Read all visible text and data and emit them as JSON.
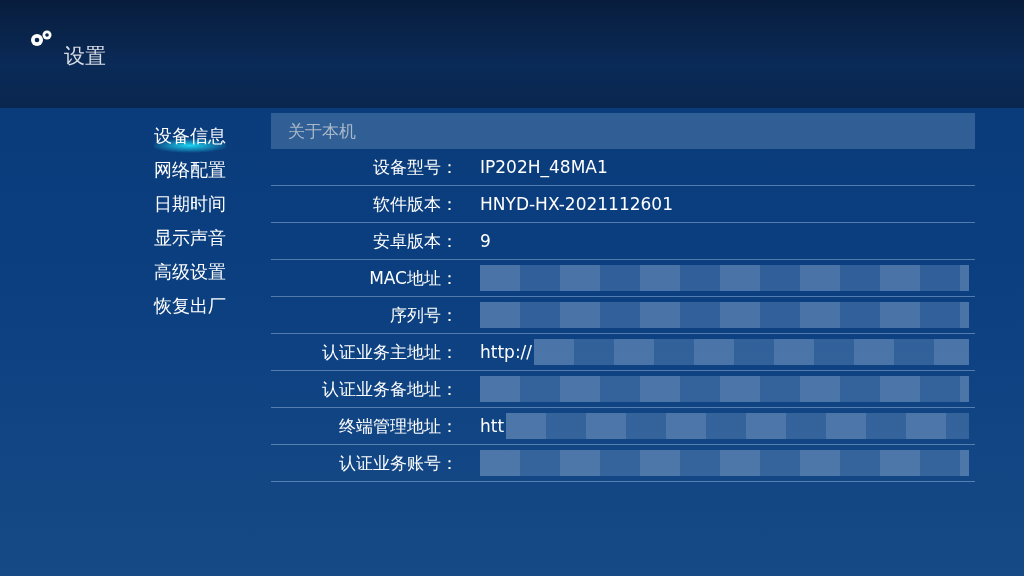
{
  "header": {
    "title": "设置"
  },
  "sidebar": {
    "items": [
      {
        "label": "设备信息",
        "selected": true
      },
      {
        "label": "网络配置",
        "selected": false
      },
      {
        "label": "日期时间",
        "selected": false
      },
      {
        "label": "显示声音",
        "selected": false
      },
      {
        "label": "高级设置",
        "selected": false
      },
      {
        "label": "恢复出厂",
        "selected": false
      }
    ]
  },
  "panel": {
    "title": "关于本机",
    "rows": [
      {
        "label": "设备型号：",
        "value": "IP202H_48MA1",
        "redacted": false
      },
      {
        "label": "软件版本：",
        "value": "HNYD-HX-2021112601",
        "redacted": false
      },
      {
        "label": "安卓版本：",
        "value": "9",
        "redacted": false
      },
      {
        "label": "MAC地址：",
        "redacted": true
      },
      {
        "label": "序列号：",
        "redacted": true
      },
      {
        "label": "认证业务主地址：",
        "value": "http://",
        "redacted": true
      },
      {
        "label": "认证业务备地址：",
        "redacted": true
      },
      {
        "label": "终端管理地址：",
        "value": "htt",
        "redacted": true
      },
      {
        "label": "认证业务账号：",
        "redacted": true
      }
    ]
  }
}
